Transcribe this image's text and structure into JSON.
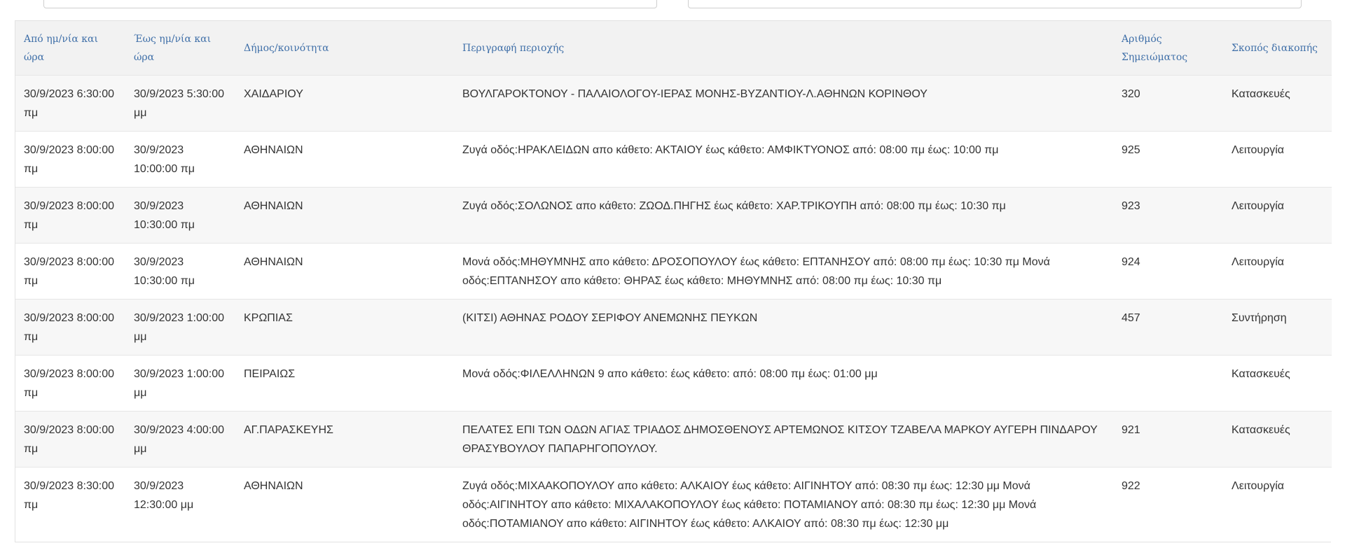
{
  "table": {
    "headers": {
      "from_datetime": "Από ημ/νία και ώρα",
      "to_datetime": "Έως ημ/νία και ώρα",
      "municipality": "Δήμος/κοινότητα",
      "area_description": "Περιγραφή περιοχής",
      "notice_number": "Αριθμός Σημειώματος",
      "purpose": "Σκοπός διακοπής"
    },
    "rows": [
      {
        "from": "30/9/2023 6:30:00 πμ",
        "to": "30/9/2023 5:30:00 μμ",
        "municipality": "ΧΑΙΔΑΡΙΟΥ",
        "area": "ΒΟΥΛΓΑΡΟΚΤΟΝΟΥ - ΠΑΛΑΙΟΛΟΓΟΥ-ΙΕΡΑΣ ΜΟΝΗΣ-ΒΥΖΑΝΤΙΟΥ-Λ.ΑΘΗΝΩΝ ΚΟΡΙΝΘΟΥ",
        "number": "320",
        "purpose": "Κατασκευές"
      },
      {
        "from": "30/9/2023 8:00:00 πμ",
        "to": "30/9/2023 10:00:00 πμ",
        "municipality": "ΑΘΗΝΑΙΩΝ",
        "area": "Ζυγά οδός:ΗΡΑΚΛΕΙΔΩΝ απο κάθετο: ΑΚΤΑΙΟΥ έως κάθετο: ΑΜΦΙΚΤΥΟΝΟΣ από: 08:00 πμ έως: 10:00 πμ",
        "number": "925",
        "purpose": "Λειτουργία"
      },
      {
        "from": "30/9/2023 8:00:00 πμ",
        "to": "30/9/2023 10:30:00 πμ",
        "municipality": "ΑΘΗΝΑΙΩΝ",
        "area": "Ζυγά οδός:ΣΟΛΩΝΟΣ απο κάθετο: ΖΩΟΔ.ΠΗΓΗΣ έως κάθετο: ΧΑΡ.ΤΡΙΚΟΥΠΗ από: 08:00 πμ έως: 10:30 πμ",
        "number": "923",
        "purpose": "Λειτουργία"
      },
      {
        "from": "30/9/2023 8:00:00 πμ",
        "to": "30/9/2023 10:30:00 πμ",
        "municipality": "ΑΘΗΝΑΙΩΝ",
        "area": "Μονά οδός:ΜΗΘΥΜΝΗΣ απο κάθετο: ΔΡΟΣΟΠΟΥΛΟΥ έως κάθετο: ΕΠΤΑΝΗΣΟΥ από: 08:00 πμ έως: 10:30 πμ Μονά οδός:ΕΠΤΑΝΗΣΟΥ απο κάθετο: ΘΗΡΑΣ έως κάθετο: ΜΗΘΥΜΝΗΣ από: 08:00 πμ έως: 10:30 πμ",
        "number": "924",
        "purpose": "Λειτουργία"
      },
      {
        "from": "30/9/2023 8:00:00 πμ",
        "to": "30/9/2023 1:00:00 μμ",
        "municipality": "ΚΡΩΠΙΑΣ",
        "area": "(ΚΙΤΣΙ) ΑΘΗΝΑΣ ΡΟΔΟΥ ΣΕΡΙΦΟΥ ΑΝΕΜΩΝΗΣ ΠΕΥΚΩΝ",
        "number": "457",
        "purpose": "Συντήρηση"
      },
      {
        "from": "30/9/2023 8:00:00 πμ",
        "to": "30/9/2023 1:00:00 μμ",
        "municipality": "ΠΕΙΡΑΙΩΣ",
        "area": "Μονά οδός:ΦΙΛΕΛΛΗΝΩΝ 9 απο κάθετο: έως κάθετο: από: 08:00 πμ έως: 01:00 μμ",
        "number": "",
        "purpose": "Κατασκευές"
      },
      {
        "from": "30/9/2023 8:00:00 πμ",
        "to": "30/9/2023 4:00:00 μμ",
        "municipality": "ΑΓ.ΠΑΡΑΣΚΕΥΗΣ",
        "area": "ΠΕΛΑΤΕΣ ΕΠΙ ΤΩΝ ΟΔΩΝ ΑΓΙΑΣ ΤΡΙΑΔΟΣ ΔΗΜΟΣΘΕΝΟΥΣ ΑΡΤΕΜΩΝΟΣ ΚΙΤΣΟΥ ΤΖΑΒΕΛΑ ΜΑΡΚΟΥ ΑΥΓΕΡΗ ΠΙΝΔΑΡΟΥ ΘΡΑΣΥΒΟΥΛΟΥ ΠΑΠΑΡΗΓΟΠΟΥΛΟΥ.",
        "number": "921",
        "purpose": "Κατασκευές"
      },
      {
        "from": "30/9/2023 8:30:00 πμ",
        "to": "30/9/2023 12:30:00 μμ",
        "municipality": "ΑΘΗΝΑΙΩΝ",
        "area": "Ζυγά οδός:ΜΙΧΑΑΚΟΠΟΥΛΟΥ απο κάθετο: ΑΛΚΑΙΟΥ έως κάθετο: ΑΙΓΙΝΗΤΟΥ από: 08:30 πμ έως: 12:30 μμ Μονά οδός:ΑΙΓΙΝΗΤΟΥ απο κάθετο: ΜΙΧΑΛΑΚΟΠΟΥΛΟΥ έως κάθετο: ΠΟΤΑΜΙΑΝΟΥ από: 08:30 πμ έως: 12:30 μμ Μονά οδός:ΠΟΤΑΜΙΑΝΟΥ απο κάθετο: ΑΙΓΙΝΗΤΟΥ έως κάθετο: ΑΛΚΑΙΟΥ από: 08:30 πμ έως: 12:30 μμ",
        "number": "922",
        "purpose": "Λειτουργία"
      }
    ]
  }
}
